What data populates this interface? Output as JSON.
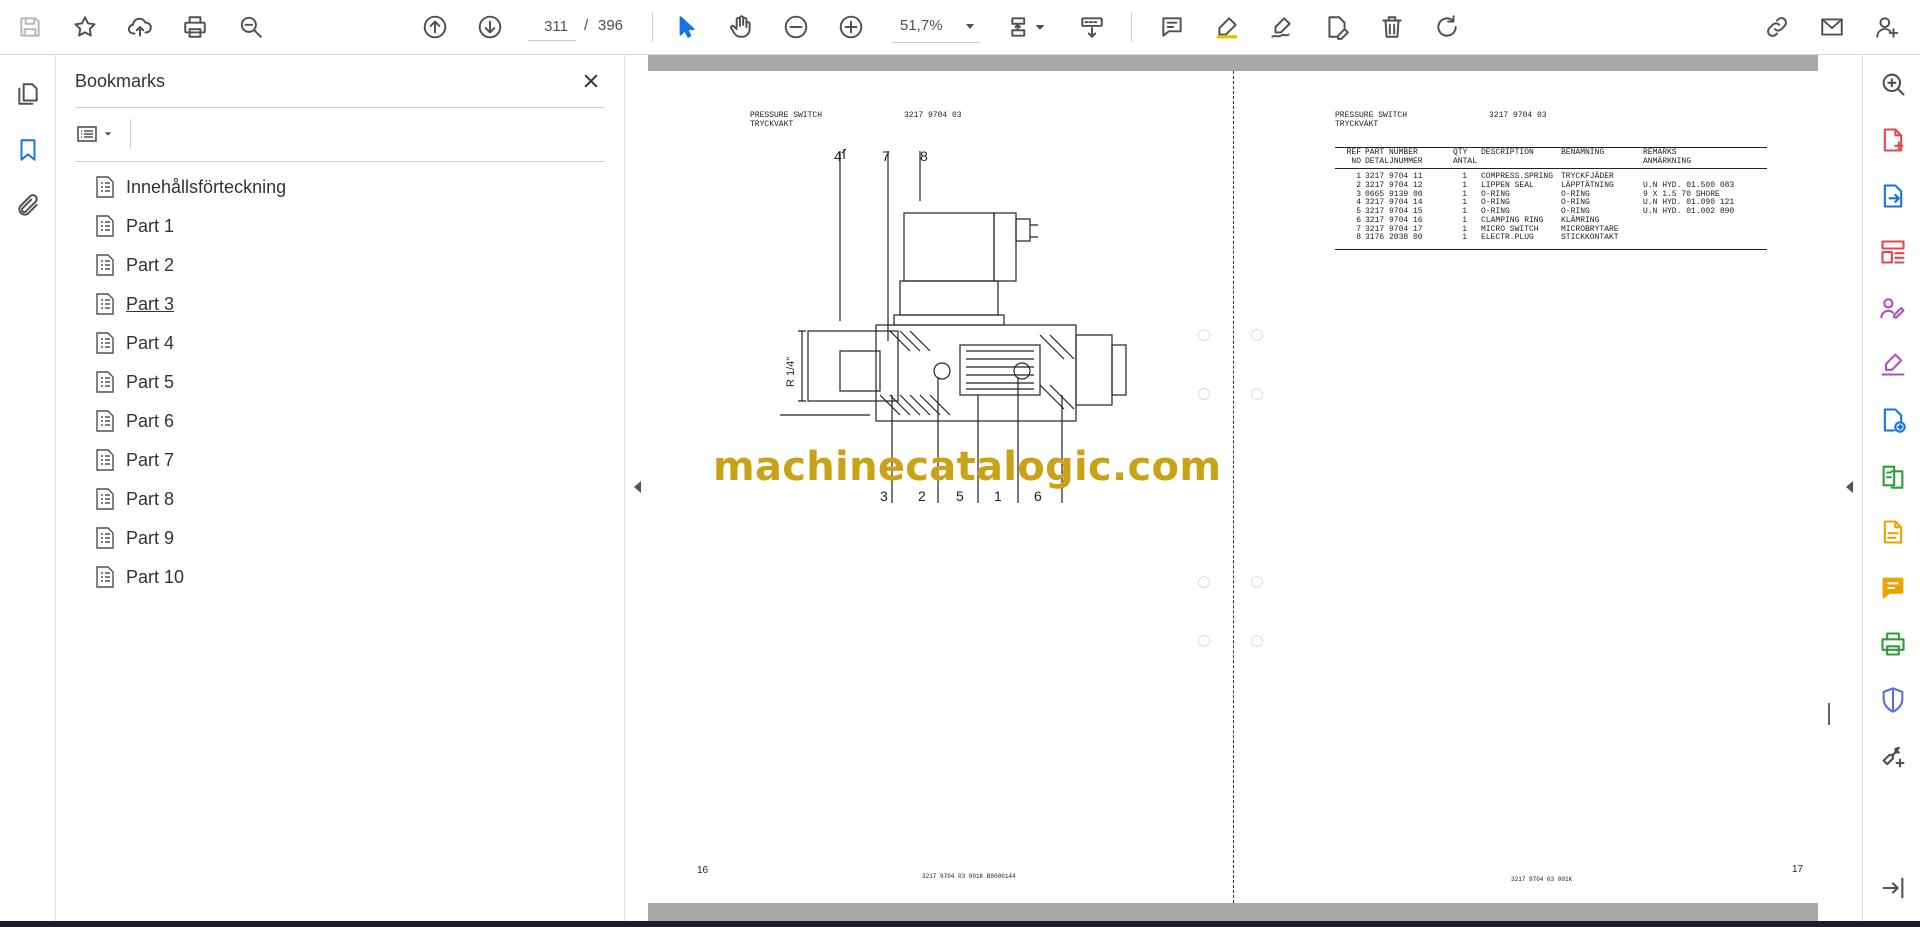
{
  "toolbar": {
    "current_page": "311",
    "page_separator": "/",
    "total_pages": "396",
    "zoom": "51,7%"
  },
  "bookmarks": {
    "title": "Bookmarks",
    "items": [
      {
        "label": "Innehållsförteckning"
      },
      {
        "label": "Part 1"
      },
      {
        "label": "Part 2"
      },
      {
        "label": "Part 3"
      },
      {
        "label": "Part 4"
      },
      {
        "label": "Part 5"
      },
      {
        "label": "Part 6"
      },
      {
        "label": "Part 7"
      },
      {
        "label": "Part 8"
      },
      {
        "label": "Part 9"
      },
      {
        "label": "Part 10"
      }
    ]
  },
  "left_page": {
    "title_line1": "PRESSURE SWITCH",
    "title_line2": "TRYCKVAKT",
    "part_code": "3217 9704 03",
    "page_number": "16",
    "footer": "3217 9704 03  001K  B8000144",
    "callouts_top": [
      "4",
      "7",
      "8"
    ],
    "callouts_bottom": [
      "3",
      "2",
      "5",
      "1",
      "6"
    ],
    "thread_label": "R 1/4\""
  },
  "right_page": {
    "title_line1": "PRESSURE SWITCH",
    "title_line2": "TRYCKVAKT",
    "part_code": "3217 9704 03",
    "page_number": "17",
    "footer": "3217 9704 03  001K",
    "table": {
      "header1": [
        "REF",
        "PART NUMBER",
        "QTY",
        "DESCRIPTION",
        "BENÄMNING",
        "REMARKS"
      ],
      "header2": [
        "NO",
        "DETALJNUMMER",
        "ANTAL",
        "",
        "",
        "ANMÄRKNING"
      ],
      "rows": [
        [
          "1",
          "3217 9704 11",
          "1",
          "COMPRESS.SPRING",
          "TRYCKFJÄDER",
          ""
        ],
        [
          "2",
          "3217 9704 12",
          "1",
          "LIPPEN SEAL",
          "LÄPPTÄTNING",
          "U.N HYD. 01.500 083"
        ],
        [
          "3",
          "0665 9139 00",
          "1",
          "O-RING",
          "O-RING",
          "9 X 1.5 70 SHORE"
        ],
        [
          "4",
          "3217 9704 14",
          "1",
          "O-RING",
          "O-RING",
          "U.N HYD. 01.090 121"
        ],
        [
          "5",
          "3217 9704 15",
          "1",
          "O-RING",
          "O-RING",
          "U.N HYD. 01.002 890"
        ],
        [
          "6",
          "3217 9704 16",
          "1",
          "CLAMPING RING",
          "KLÄMRING",
          ""
        ],
        [
          "7",
          "3217 9704 17",
          "1",
          "MICRO SWITCH",
          "MICROBRYTARE",
          ""
        ],
        [
          "8",
          "3176 2038 00",
          "1",
          "ELECTR.PLUG",
          "STICKKONTAKT",
          ""
        ]
      ]
    }
  },
  "watermark": "machinecatalogic.com",
  "colors": {
    "accent_blue": "#1473e6",
    "watermark": "#c9a317",
    "icon_gray": "#505050"
  }
}
